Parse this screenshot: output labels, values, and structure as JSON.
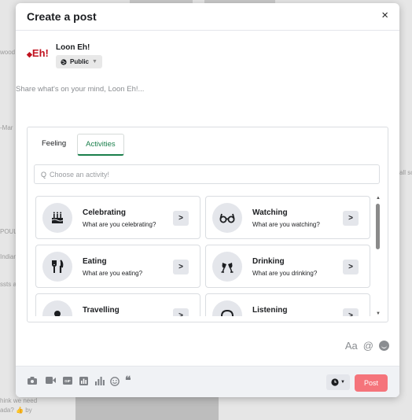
{
  "background": {
    "snippets": [
      "wood",
      "-Mar",
      "all sc",
      "POULAR",
      "Indian",
      "ssts a",
      "hink we need",
      "ada? 👍 by"
    ]
  },
  "modal": {
    "title": "Create a post",
    "close_label": "×"
  },
  "author": {
    "logo_text": "Eh!",
    "name": "Loon Eh!",
    "privacy_label": "Public",
    "privacy_icon": "globe-icon"
  },
  "composer": {
    "placeholder": "Share what's on your mind, Loon Eh!..."
  },
  "tabs": [
    {
      "label": "Feeling",
      "active": false
    },
    {
      "label": "Activities",
      "active": true
    }
  ],
  "search": {
    "placeholder": "Choose an activity!"
  },
  "activities": [
    {
      "title": "Celebrating",
      "subtitle": "What are you celebrating?",
      "icon": "birthday-cake-icon"
    },
    {
      "title": "Watching",
      "subtitle": "What are you watching?",
      "icon": "glasses-icon"
    },
    {
      "title": "Eating",
      "subtitle": "What are you eating?",
      "icon": "utensils-icon"
    },
    {
      "title": "Drinking",
      "subtitle": "What are you drinking?",
      "icon": "cheers-icon"
    },
    {
      "title": "Travelling",
      "subtitle": "",
      "icon": "map-pin-icon"
    },
    {
      "title": "Listening",
      "subtitle": "",
      "icon": "headphones-icon"
    }
  ],
  "text_tools": {
    "font_label": "Aa",
    "mention_label": "@"
  },
  "footer": {
    "tools": [
      "camera-icon",
      "video-icon",
      "gif-icon",
      "bar-chart-icon",
      "poll-icon",
      "smiley-icon",
      "quote-icon"
    ],
    "gif_label": "GIF",
    "post_label": "Post"
  },
  "colors": {
    "accent_green": "#1a7f4b",
    "post_button": "#f5747b",
    "logo_red": "#c1121f"
  }
}
